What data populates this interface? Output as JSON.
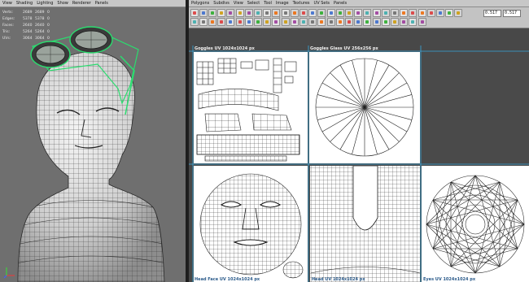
{
  "viewport": {
    "menu": [
      "View",
      "Shading",
      "Lighting",
      "Show",
      "Renderer",
      "Panels"
    ],
    "hud": [
      {
        "label": "Verts:",
        "a": "2689",
        "b": "2689",
        "c": "0"
      },
      {
        "label": "Edges:",
        "a": "5378",
        "b": "5378",
        "c": "0"
      },
      {
        "label": "Faces:",
        "a": "2640",
        "b": "2640",
        "c": "0"
      },
      {
        "label": "Tris:",
        "a": "5264",
        "b": "5264",
        "c": "0"
      },
      {
        "label": "UVs:",
        "a": "3064",
        "b": "3064",
        "c": "0"
      }
    ],
    "colors": {
      "bg": "#6f6f6f",
      "mesh_fill": "#d9d9d9",
      "wire": "#303030",
      "goggles_select": "#2bdc6f"
    }
  },
  "uv_editor": {
    "menu": [
      "Polygons",
      "Subdivs",
      "View",
      "Select",
      "Tool",
      "Image",
      "Textures",
      "UV Sets",
      "Panels"
    ],
    "toolbar": {
      "field_u": "0.517",
      "field_v": "0.517",
      "icon_names": [
        "select-icon",
        "move-uv-icon",
        "rotate-uv-icon",
        "scale-uv-icon",
        "flip-u-icon",
        "flip-v-icon",
        "grid-uv-icon",
        "cut-uv-icon",
        "sew-uv-icon",
        "layout-icon",
        "unfold-icon",
        "relax-icon",
        "snapshot-icon",
        "checker-icon",
        "texture-icon",
        "uv-shell-icon",
        "isolate-icon",
        "frame-icon",
        "pin-icon",
        "display-image-icon"
      ]
    },
    "tiles": [
      {
        "label": "Goggles UV 1024x1024 px"
      },
      {
        "label": "Goggles Glass UV 256x256 px"
      },
      {
        "label": "Head Face UV 1024x1024 px"
      },
      {
        "label": "Head UV 1024x1024 px"
      },
      {
        "label": "Eyes UV 1024x1024 px"
      }
    ],
    "colors": {
      "bg": "#484848",
      "tile_bg": "#ffffff",
      "tile_border": "#38a7dd",
      "uv_wire": "#1e1e1e"
    }
  }
}
